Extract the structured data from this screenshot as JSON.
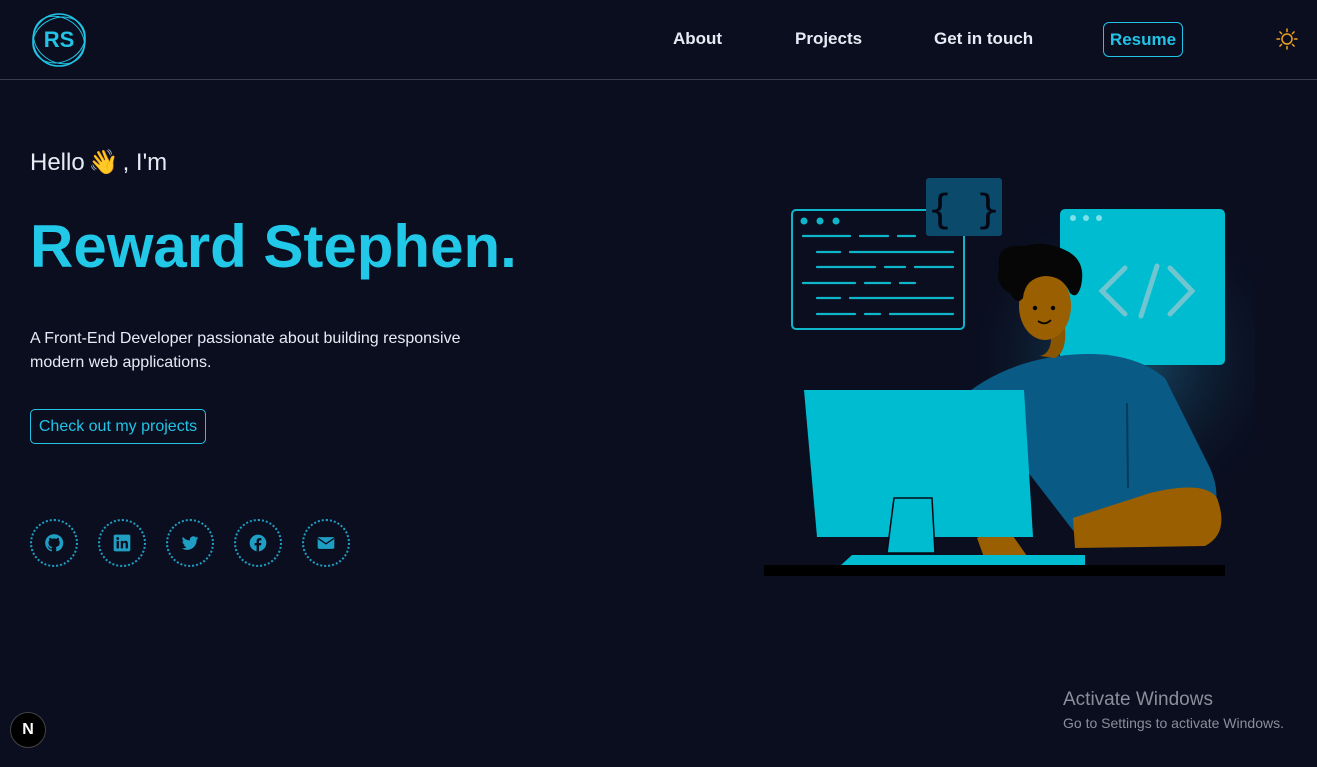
{
  "nav": {
    "logo_text": "RS",
    "links": [
      "About",
      "Projects",
      "Get in touch"
    ],
    "resume_label": "Resume",
    "theme_icon": "sun-icon"
  },
  "hero": {
    "greeting_before": "Hello",
    "greeting_emoji": "👋",
    "greeting_after": ", I'm",
    "name": "Reward Stephen.",
    "tagline": "A Front-End Developer passionate about building responsive modern web applications.",
    "cta_label": "Check out my projects"
  },
  "socials": [
    "github-icon",
    "linkedin-icon",
    "twitter-icon",
    "facebook-icon",
    "email-icon"
  ],
  "illustration": {
    "code_braces": "{ }",
    "code_tag": "</>"
  },
  "os_overlay": {
    "title": "Activate Windows",
    "subtitle": "Go to Settings to activate Windows."
  },
  "dev_badge": "N",
  "colors": {
    "background": "#0a0e1f",
    "accent": "#22c3e6",
    "nav_text": "#e6ecf5"
  }
}
